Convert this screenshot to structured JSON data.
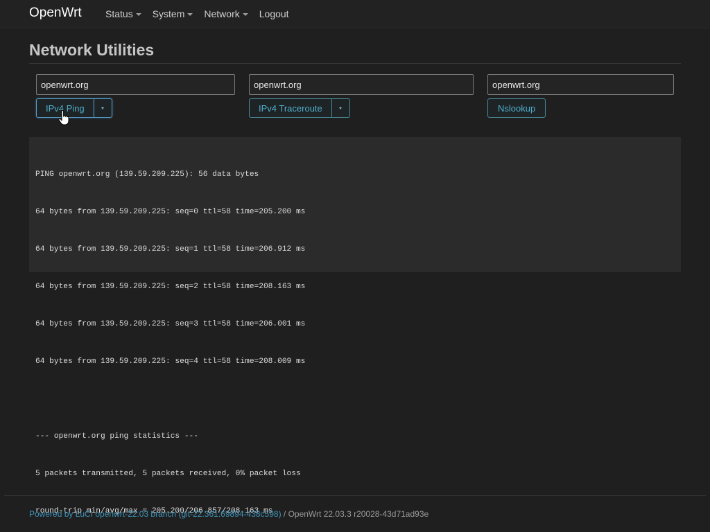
{
  "brand": "OpenWrt",
  "nav": {
    "items": [
      {
        "label": "Status",
        "has_dropdown": true
      },
      {
        "label": "System",
        "has_dropdown": true
      },
      {
        "label": "Network",
        "has_dropdown": true
      },
      {
        "label": "Logout",
        "has_dropdown": false
      }
    ]
  },
  "page": {
    "title": "Network Utilities"
  },
  "tools": {
    "ping": {
      "host": "openwrt.org",
      "button_label": "IPv4 Ping"
    },
    "traceroute": {
      "host": "openwrt.org",
      "button_label": "IPv4 Traceroute"
    },
    "nslookup": {
      "host": "openwrt.org",
      "button_label": "Nslookup"
    }
  },
  "output": {
    "lines": [
      "PING openwrt.org (139.59.209.225): 56 data bytes",
      "64 bytes from 139.59.209.225: seq=0 ttl=58 time=205.200 ms",
      "64 bytes from 139.59.209.225: seq=1 ttl=58 time=206.912 ms",
      "64 bytes from 139.59.209.225: seq=2 ttl=58 time=208.163 ms",
      "64 bytes from 139.59.209.225: seq=3 ttl=58 time=206.001 ms",
      "64 bytes from 139.59.209.225: seq=4 ttl=58 time=208.009 ms",
      "",
      "--- openwrt.org ping statistics ---",
      "5 packets transmitted, 5 packets received, 0% packet loss",
      "round-trip min/avg/max = 205.200/206.857/208.163 ms"
    ]
  },
  "footer": {
    "link_text": "Powered by LuCI openwrt-22.03 branch (git-22.361.69894-438c598)",
    "version_text": " / OpenWrt 22.03.3 r20028-43d71ad93e"
  },
  "colors": {
    "background": "#1f1f20",
    "accent": "#4fb0cc",
    "link": "#3f93b5"
  }
}
